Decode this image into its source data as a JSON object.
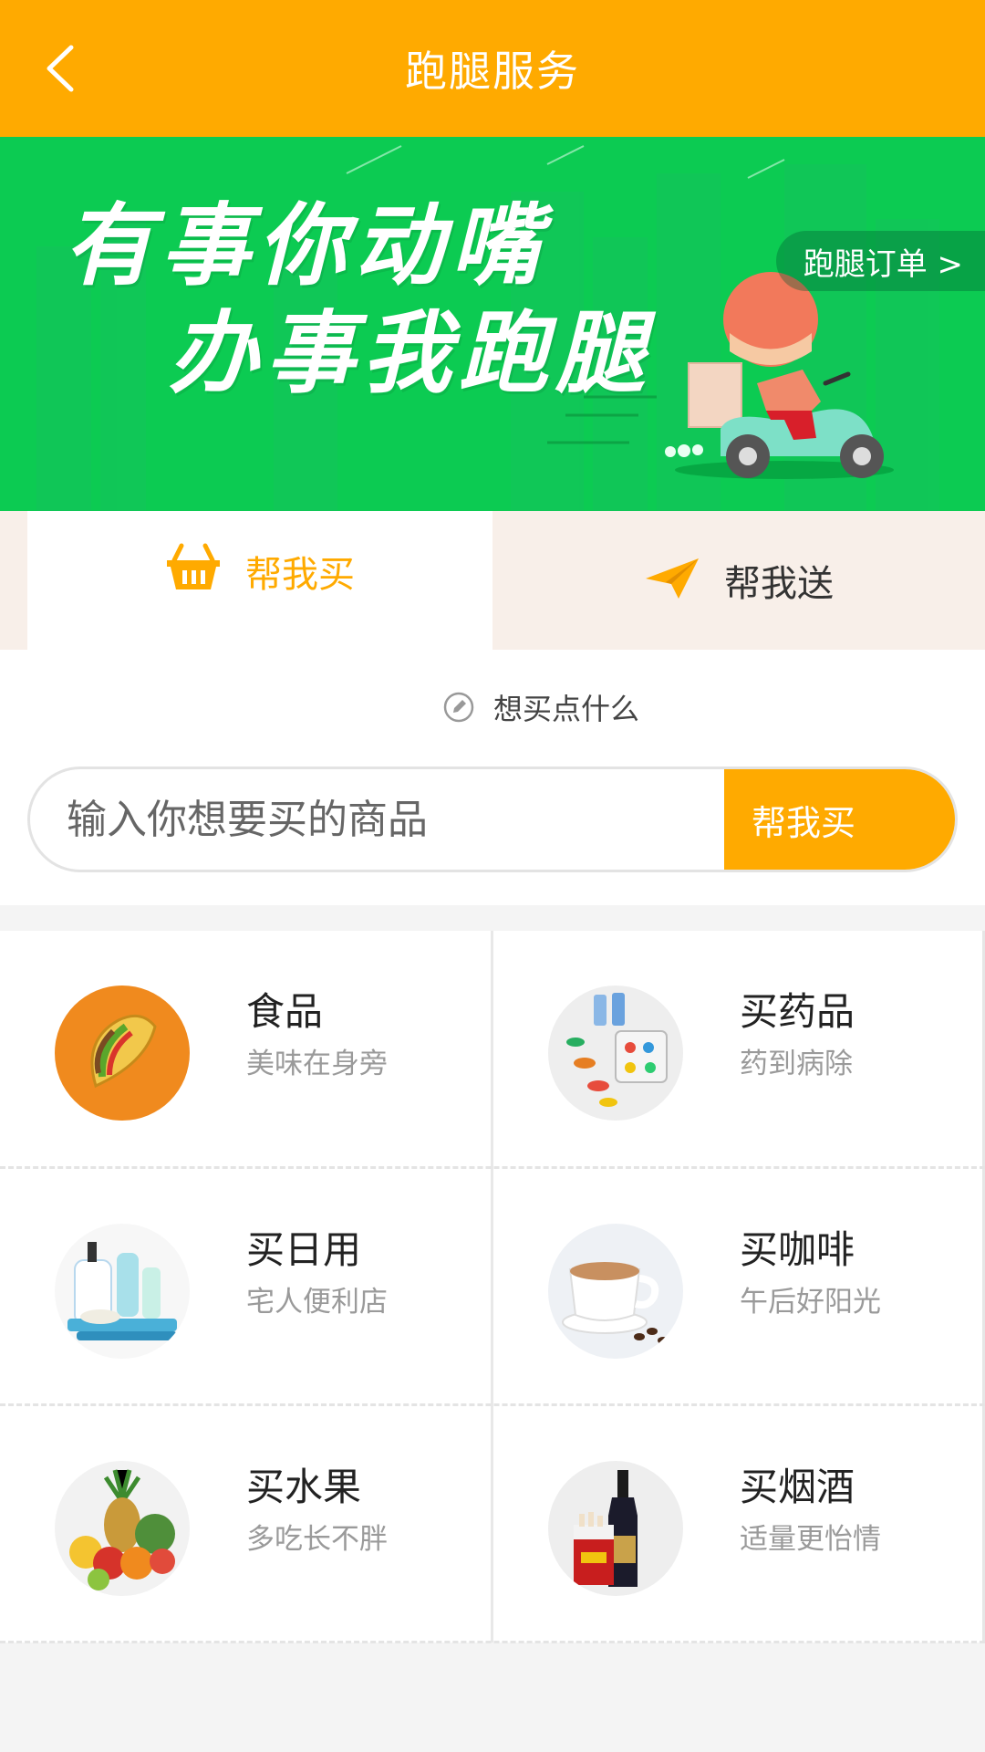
{
  "header": {
    "title": "跑腿服务",
    "back_icon": "chevron-left-icon"
  },
  "banner": {
    "slogan_line1": "有事你动嘴",
    "slogan_line2": "办事我跑腿",
    "order_link": "跑腿订单 >",
    "illustration": "delivery-scooter-rider"
  },
  "tabs": [
    {
      "label": "帮我买",
      "icon": "basket-icon",
      "active": true,
      "color": "#ffaa00"
    },
    {
      "label": "帮我送",
      "icon": "paper-plane-icon",
      "active": false
    }
  ],
  "prompt": {
    "icon": "pencil-icon",
    "text": "想买点什么"
  },
  "search": {
    "placeholder": "输入你想要买的商品",
    "value": "",
    "button_label": "帮我买"
  },
  "categories": [
    {
      "title": "食品",
      "subtitle": "美味在身旁",
      "icon": "taco-icon"
    },
    {
      "title": "买药品",
      "subtitle": "药到病除",
      "icon": "pills-icon"
    },
    {
      "title": "买日用",
      "subtitle": "宅人便利店",
      "icon": "toiletries-icon"
    },
    {
      "title": "买咖啡",
      "subtitle": "午后好阳光",
      "icon": "coffee-cup-icon"
    },
    {
      "title": "买水果",
      "subtitle": "多吃长不胖",
      "icon": "fruit-basket-icon"
    },
    {
      "title": "买烟酒",
      "subtitle": "适量更怡情",
      "icon": "wine-cigarettes-icon"
    }
  ],
  "colors": {
    "accent": "#ffaa00",
    "banner": "#0ccb52",
    "tab_bg": "#f8efe9"
  }
}
